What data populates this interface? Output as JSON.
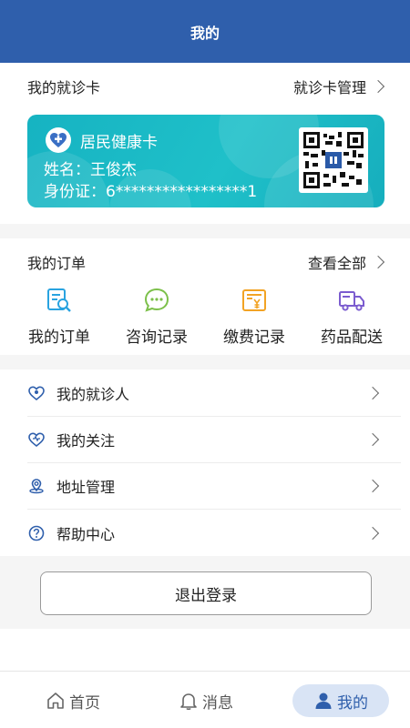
{
  "header": {
    "title": "我的"
  },
  "card_section": {
    "title": "我的就诊卡",
    "link": "就诊卡管理"
  },
  "card": {
    "title": "居民健康卡",
    "name": "姓名：王俊杰",
    "id_number": "身份证：6*****************1"
  },
  "orders_section": {
    "title": "我的订单",
    "link": "查看全部"
  },
  "orders": [
    {
      "label": "我的订单",
      "icon": "order-search-icon",
      "color": "#29a3e0"
    },
    {
      "label": "咨询记录",
      "icon": "chat-bubble-icon",
      "color": "#7cc04a"
    },
    {
      "label": "缴费记录",
      "icon": "payment-receipt-icon",
      "color": "#f2a324"
    },
    {
      "label": "药品配送",
      "icon": "delivery-truck-icon",
      "color": "#7b5ccf"
    }
  ],
  "menu": [
    {
      "label": "我的就诊人",
      "icon": "patient-icon"
    },
    {
      "label": "我的关注",
      "icon": "heart-icon"
    },
    {
      "label": "地址管理",
      "icon": "location-icon"
    },
    {
      "label": "帮助中心",
      "icon": "help-icon"
    }
  ],
  "logout": {
    "label": "退出登录"
  },
  "tabbar": {
    "home": "首页",
    "messages": "消息",
    "mine": "我的"
  },
  "colors": {
    "brand": "#2f5fac",
    "card": "#16b3c2",
    "active_tab_bg": "#d9e4f5"
  }
}
